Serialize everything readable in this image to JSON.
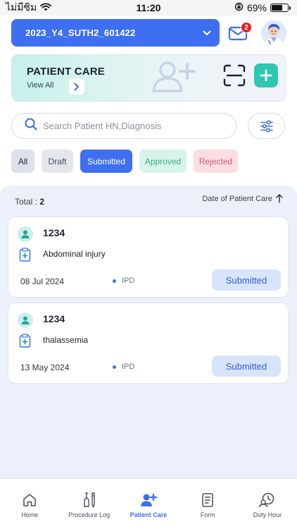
{
  "status_bar": {
    "carrier": "ไม่มีซิม",
    "time": "11:20",
    "battery": "69%",
    "battery_level": 0.69
  },
  "header": {
    "site_label": "2023_Y4_SUTH2_601422",
    "mail_badge": "2"
  },
  "care_card": {
    "title": "PATIENT CARE",
    "view_all": "View All"
  },
  "search": {
    "placeholder": "Search Patient HN,Diagnosis",
    "value": ""
  },
  "filters": [
    {
      "label": "All"
    },
    {
      "label": "Draft"
    },
    {
      "label": "Submitted",
      "active": true
    },
    {
      "label": "Approved"
    },
    {
      "label": "Rejected"
    }
  ],
  "list": {
    "total_label": "Total :",
    "total_value": "2",
    "sort_label": "Date of Patient Care",
    "items": [
      {
        "hn": "1234",
        "diagnosis": "Abdominal injury",
        "date": "08 Jul 2024",
        "type": "IPD",
        "status": "Submitted"
      },
      {
        "hn": "1234",
        "diagnosis": "thalassemia",
        "date": "13 May 2024",
        "type": "IPD",
        "status": "Submitted"
      }
    ]
  },
  "nav": [
    {
      "label": "Home",
      "icon": "home-icon"
    },
    {
      "label": "Procedure Log",
      "icon": "procedure-log-icon"
    },
    {
      "label": "Patient Care",
      "icon": "patient-care-icon",
      "active": true
    },
    {
      "label": "Form",
      "icon": "form-icon"
    },
    {
      "label": "Duty Hour",
      "icon": "duty-hour-icon"
    }
  ],
  "colors": {
    "primary": "#3d6ff0",
    "accent": "#2cc8b1",
    "panel": "#ebf0fa"
  }
}
